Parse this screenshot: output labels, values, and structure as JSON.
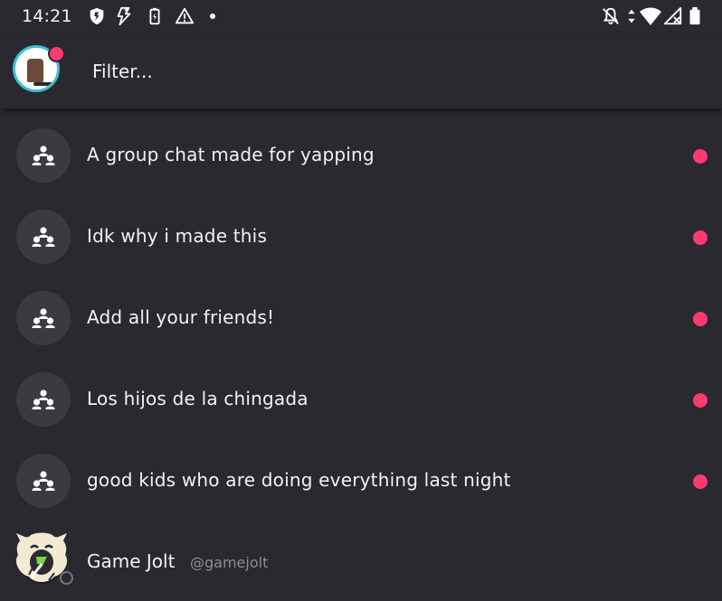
{
  "status_bar": {
    "time": "14:21",
    "left_icons": [
      "shield-icon",
      "flash-icon",
      "battery-saver-icon",
      "warning-icon",
      "dot-icon"
    ],
    "right_icons": [
      "notifications-off-icon",
      "data-arrows-icon",
      "wifi-icon",
      "signal-icon",
      "battery-icon"
    ]
  },
  "header": {
    "avatar": "profile-avatar",
    "has_notification": true,
    "filter_placeholder": "Filter..."
  },
  "chats": [
    {
      "name": "A group chat made for yapping",
      "unread": true
    },
    {
      "name": "Idk why i made this",
      "unread": true
    },
    {
      "name": "Add all your friends!",
      "unread": true
    },
    {
      "name": "Los hijos de la chingada",
      "unread": true
    },
    {
      "name": "good kids who are doing everything last night",
      "unread": true
    }
  ],
  "friend": {
    "name": "Game Jolt",
    "handle": "@gamejolt",
    "status": "offline"
  },
  "colors": {
    "background": "#2a2930",
    "accent_dot": "#ff3a6e",
    "avatar_bg": "#3b3a41",
    "avatar_ring": "#39c2d6",
    "muted_text": "#8d8c94"
  }
}
